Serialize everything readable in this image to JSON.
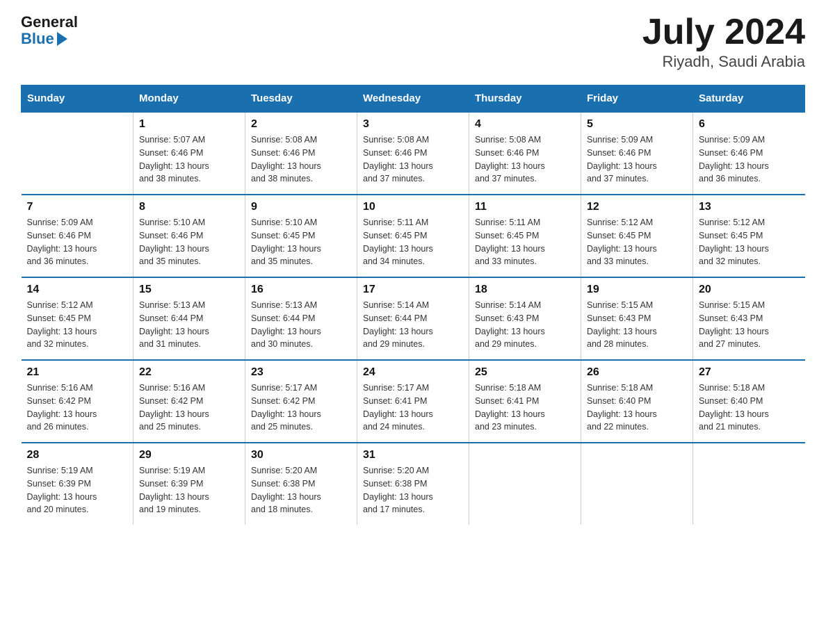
{
  "header": {
    "logo": {
      "general": "General",
      "blue": "Blue",
      "arrow": "▶"
    },
    "title": "July 2024",
    "location": "Riyadh, Saudi Arabia"
  },
  "days_of_week": [
    "Sunday",
    "Monday",
    "Tuesday",
    "Wednesday",
    "Thursday",
    "Friday",
    "Saturday"
  ],
  "weeks": [
    [
      {
        "day": "",
        "info": ""
      },
      {
        "day": "1",
        "info": "Sunrise: 5:07 AM\nSunset: 6:46 PM\nDaylight: 13 hours\nand 38 minutes."
      },
      {
        "day": "2",
        "info": "Sunrise: 5:08 AM\nSunset: 6:46 PM\nDaylight: 13 hours\nand 38 minutes."
      },
      {
        "day": "3",
        "info": "Sunrise: 5:08 AM\nSunset: 6:46 PM\nDaylight: 13 hours\nand 37 minutes."
      },
      {
        "day": "4",
        "info": "Sunrise: 5:08 AM\nSunset: 6:46 PM\nDaylight: 13 hours\nand 37 minutes."
      },
      {
        "day": "5",
        "info": "Sunrise: 5:09 AM\nSunset: 6:46 PM\nDaylight: 13 hours\nand 37 minutes."
      },
      {
        "day": "6",
        "info": "Sunrise: 5:09 AM\nSunset: 6:46 PM\nDaylight: 13 hours\nand 36 minutes."
      }
    ],
    [
      {
        "day": "7",
        "info": "Sunrise: 5:09 AM\nSunset: 6:46 PM\nDaylight: 13 hours\nand 36 minutes."
      },
      {
        "day": "8",
        "info": "Sunrise: 5:10 AM\nSunset: 6:46 PM\nDaylight: 13 hours\nand 35 minutes."
      },
      {
        "day": "9",
        "info": "Sunrise: 5:10 AM\nSunset: 6:45 PM\nDaylight: 13 hours\nand 35 minutes."
      },
      {
        "day": "10",
        "info": "Sunrise: 5:11 AM\nSunset: 6:45 PM\nDaylight: 13 hours\nand 34 minutes."
      },
      {
        "day": "11",
        "info": "Sunrise: 5:11 AM\nSunset: 6:45 PM\nDaylight: 13 hours\nand 33 minutes."
      },
      {
        "day": "12",
        "info": "Sunrise: 5:12 AM\nSunset: 6:45 PM\nDaylight: 13 hours\nand 33 minutes."
      },
      {
        "day": "13",
        "info": "Sunrise: 5:12 AM\nSunset: 6:45 PM\nDaylight: 13 hours\nand 32 minutes."
      }
    ],
    [
      {
        "day": "14",
        "info": "Sunrise: 5:12 AM\nSunset: 6:45 PM\nDaylight: 13 hours\nand 32 minutes."
      },
      {
        "day": "15",
        "info": "Sunrise: 5:13 AM\nSunset: 6:44 PM\nDaylight: 13 hours\nand 31 minutes."
      },
      {
        "day": "16",
        "info": "Sunrise: 5:13 AM\nSunset: 6:44 PM\nDaylight: 13 hours\nand 30 minutes."
      },
      {
        "day": "17",
        "info": "Sunrise: 5:14 AM\nSunset: 6:44 PM\nDaylight: 13 hours\nand 29 minutes."
      },
      {
        "day": "18",
        "info": "Sunrise: 5:14 AM\nSunset: 6:43 PM\nDaylight: 13 hours\nand 29 minutes."
      },
      {
        "day": "19",
        "info": "Sunrise: 5:15 AM\nSunset: 6:43 PM\nDaylight: 13 hours\nand 28 minutes."
      },
      {
        "day": "20",
        "info": "Sunrise: 5:15 AM\nSunset: 6:43 PM\nDaylight: 13 hours\nand 27 minutes."
      }
    ],
    [
      {
        "day": "21",
        "info": "Sunrise: 5:16 AM\nSunset: 6:42 PM\nDaylight: 13 hours\nand 26 minutes."
      },
      {
        "day": "22",
        "info": "Sunrise: 5:16 AM\nSunset: 6:42 PM\nDaylight: 13 hours\nand 25 minutes."
      },
      {
        "day": "23",
        "info": "Sunrise: 5:17 AM\nSunset: 6:42 PM\nDaylight: 13 hours\nand 25 minutes."
      },
      {
        "day": "24",
        "info": "Sunrise: 5:17 AM\nSunset: 6:41 PM\nDaylight: 13 hours\nand 24 minutes."
      },
      {
        "day": "25",
        "info": "Sunrise: 5:18 AM\nSunset: 6:41 PM\nDaylight: 13 hours\nand 23 minutes."
      },
      {
        "day": "26",
        "info": "Sunrise: 5:18 AM\nSunset: 6:40 PM\nDaylight: 13 hours\nand 22 minutes."
      },
      {
        "day": "27",
        "info": "Sunrise: 5:18 AM\nSunset: 6:40 PM\nDaylight: 13 hours\nand 21 minutes."
      }
    ],
    [
      {
        "day": "28",
        "info": "Sunrise: 5:19 AM\nSunset: 6:39 PM\nDaylight: 13 hours\nand 20 minutes."
      },
      {
        "day": "29",
        "info": "Sunrise: 5:19 AM\nSunset: 6:39 PM\nDaylight: 13 hours\nand 19 minutes."
      },
      {
        "day": "30",
        "info": "Sunrise: 5:20 AM\nSunset: 6:38 PM\nDaylight: 13 hours\nand 18 minutes."
      },
      {
        "day": "31",
        "info": "Sunrise: 5:20 AM\nSunset: 6:38 PM\nDaylight: 13 hours\nand 17 minutes."
      },
      {
        "day": "",
        "info": ""
      },
      {
        "day": "",
        "info": ""
      },
      {
        "day": "",
        "info": ""
      }
    ]
  ]
}
